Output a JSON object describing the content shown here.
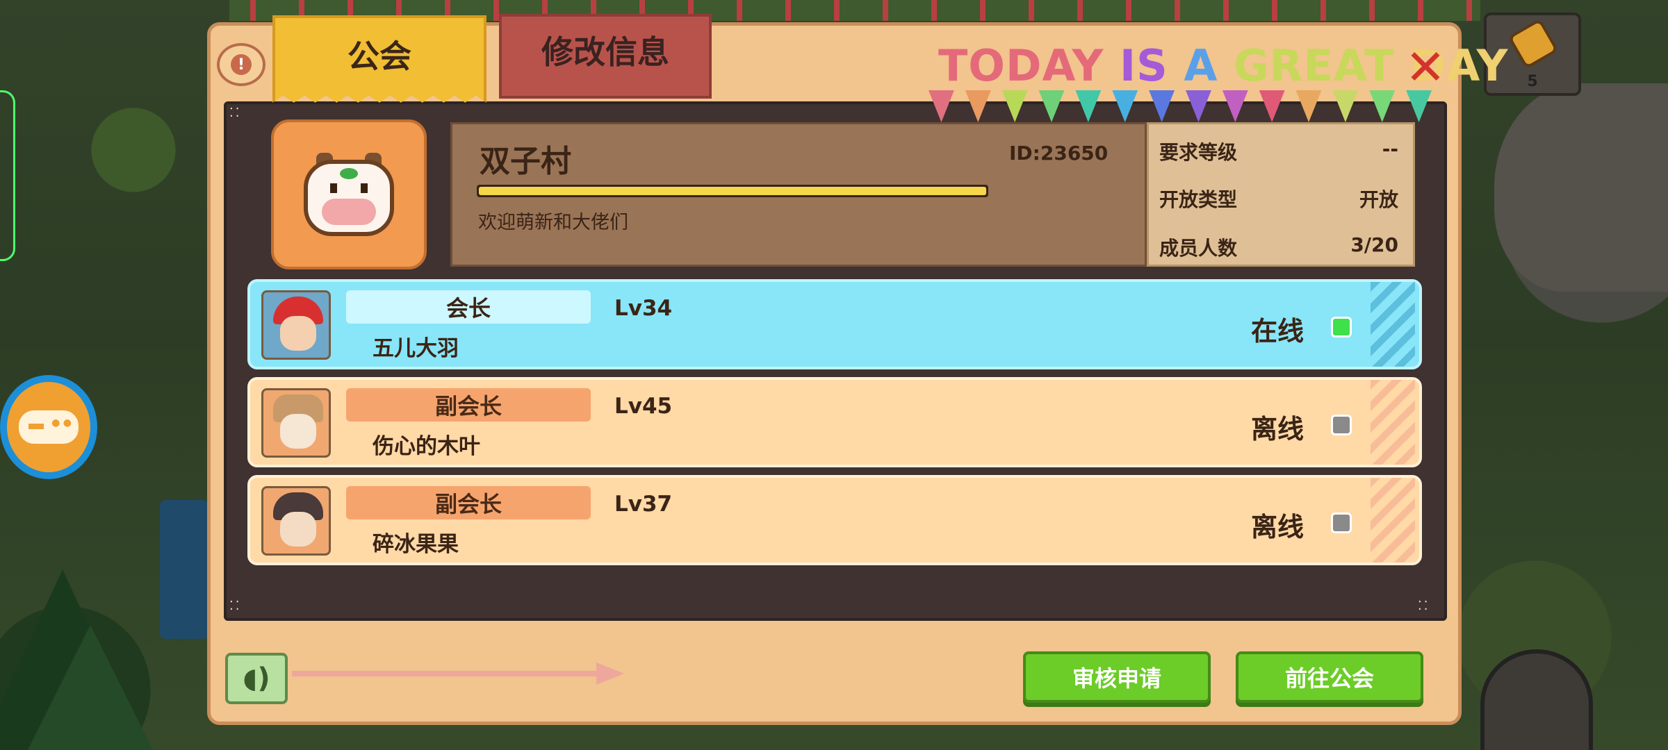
{
  "top_item": {
    "count": "5"
  },
  "tabs": {
    "guild": "公会",
    "edit": "修改信息"
  },
  "banner": {
    "letters": [
      {
        "t": "TODAY",
        "c": "#e46a7a"
      },
      {
        "t": " ",
        "c": "#000"
      },
      {
        "t": "IS",
        "c": "#a55ad8"
      },
      {
        "t": " ",
        "c": "#000"
      },
      {
        "t": "A",
        "c": "#5aa0e8"
      },
      {
        "t": " ",
        "c": "#000"
      },
      {
        "t": "GREAT",
        "c": "#c8d85a"
      },
      {
        "t": " ",
        "c": "#000"
      },
      {
        "t": "DAY",
        "c": "#f0d070"
      }
    ],
    "flag_colors": [
      "#e07080",
      "#e89a60",
      "#b8d858",
      "#6ed078",
      "#40c8a8",
      "#48b0e0",
      "#5a78e0",
      "#8a60d8",
      "#c060c0",
      "#e05a78",
      "#e8a860",
      "#c8d868",
      "#78d878",
      "#48c8a0"
    ]
  },
  "guild": {
    "name": "双子村",
    "id": "ID:23650",
    "progress": 1.0,
    "description": "欢迎萌新和大佬们",
    "stats": {
      "level_label": "要求等级",
      "level_value": "--",
      "type_label": "开放类型",
      "type_value": "开放",
      "members_label": "成员人数",
      "members_value": "3/20"
    }
  },
  "members": [
    {
      "role": "会长",
      "name": "五儿大羽",
      "level": "Lv34",
      "status": "在线",
      "online": true
    },
    {
      "role": "副会长",
      "name": "伤心的木叶",
      "level": "Lv45",
      "status": "离线",
      "online": false
    },
    {
      "role": "副会长",
      "name": "碎冰果果",
      "level": "Lv37",
      "status": "离线",
      "online": false
    }
  ],
  "buttons": {
    "review": "审核申请",
    "goto": "前往公会"
  },
  "colors": {
    "online_dot": "#3fe04a",
    "offline_dot": "#8a8a8a",
    "panel": "#f2c48e"
  }
}
